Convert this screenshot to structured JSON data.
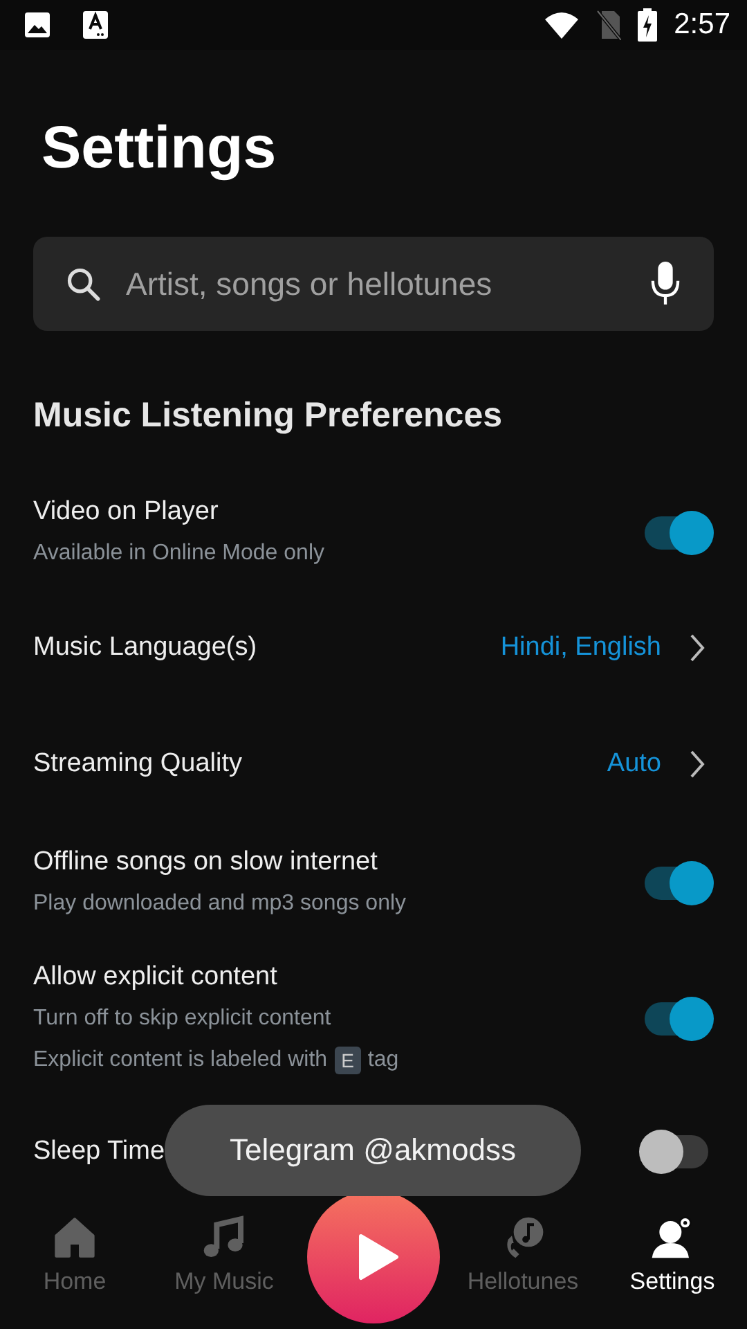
{
  "status_bar": {
    "time": "2:57"
  },
  "title": "Settings",
  "search": {
    "placeholder": "Artist, songs or hellotunes"
  },
  "section_title": "Music Listening Preferences",
  "settings": [
    {
      "kind": "toggle",
      "title": "Video on Player",
      "subtitles": [
        "Available in Online Mode only"
      ],
      "on": true
    },
    {
      "kind": "link",
      "title": "Music Language(s)",
      "value": "Hindi, English"
    },
    {
      "kind": "link",
      "title": "Streaming Quality",
      "value": "Auto"
    },
    {
      "kind": "toggle",
      "title": "Offline songs on slow internet",
      "subtitles": [
        "Play downloaded and mp3 songs only"
      ],
      "on": true
    },
    {
      "kind": "toggle",
      "title": "Allow explicit content",
      "subtitles": [
        "Turn off to skip explicit content"
      ],
      "note": {
        "before": "Explicit content is labeled with",
        "tag": "E",
        "after": "tag"
      },
      "on": true
    },
    {
      "kind": "toggle",
      "title": "Sleep Time",
      "on": false
    }
  ],
  "toast": "Telegram @akmodss",
  "nav": [
    {
      "kind": "home",
      "label": "Home",
      "selected": false
    },
    {
      "kind": "music",
      "label": "My Music",
      "selected": false
    },
    {
      "kind": "play"
    },
    {
      "kind": "hellotunes",
      "label": "Hellotunes",
      "selected": false
    },
    {
      "kind": "settings",
      "label": "Settings",
      "selected": true
    }
  ]
}
